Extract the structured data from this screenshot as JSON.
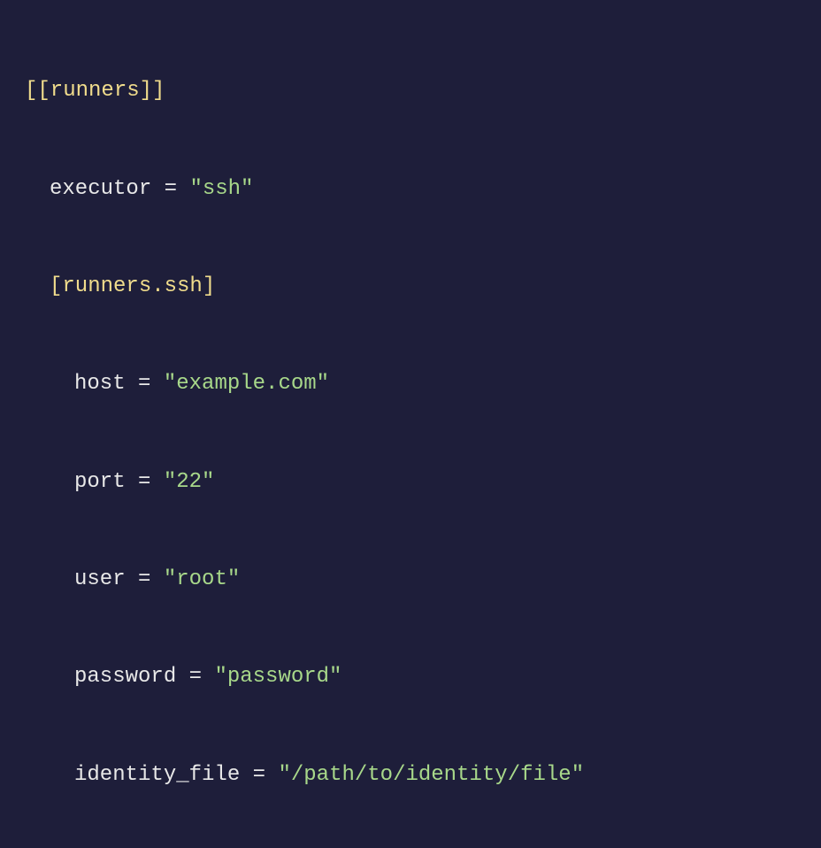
{
  "code": {
    "line1": {
      "bracket": "[[runners]]"
    },
    "line2": {
      "key": "executor",
      "eq": " = ",
      "value": "\"ssh\""
    },
    "line3": {
      "bracket": "[runners.ssh]"
    },
    "line4": {
      "key": "host",
      "eq": " = ",
      "value": "\"example.com\""
    },
    "line5": {
      "key": "port",
      "eq": " = ",
      "value": "\"22\""
    },
    "line6": {
      "key": "user",
      "eq": " = ",
      "value": "\"root\""
    },
    "line7": {
      "key": "password",
      "eq": " = ",
      "value": "\"password\""
    },
    "line8": {
      "key": "identity_file",
      "eq": " = ",
      "value": "\"/path/to/identity/file\""
    }
  }
}
